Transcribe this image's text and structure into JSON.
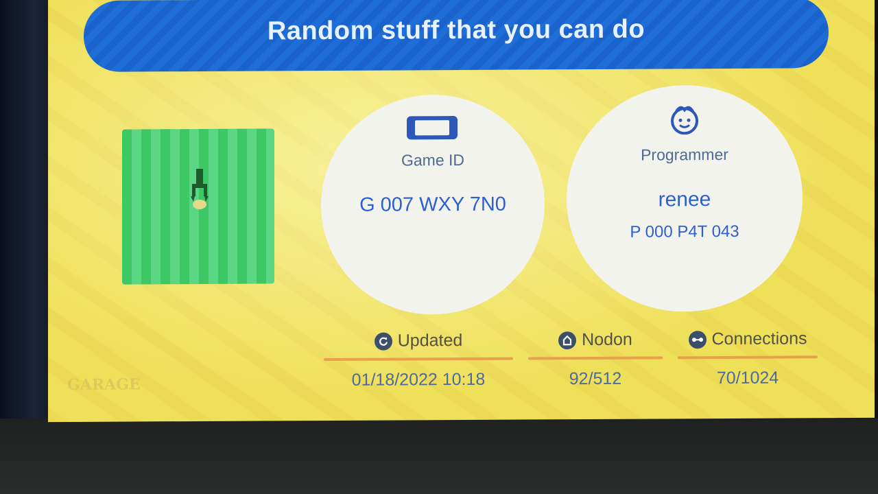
{
  "banner": {
    "title": "Random stuff that you can do"
  },
  "game": {
    "label": "Game ID",
    "id": "G 007 WXY 7N0"
  },
  "programmer": {
    "label": "Programmer",
    "name": "renee",
    "id": "P 000 P4T 043"
  },
  "stats": {
    "updated": {
      "label": "Updated",
      "value": "01/18/2022 10:18"
    },
    "nodon": {
      "label": "Nodon",
      "value": "92/512"
    },
    "connections": {
      "label": "Connections",
      "value": "70/1024"
    }
  },
  "logo": {
    "text": "GARAGE"
  },
  "colors": {
    "banner": "#1f6ed8",
    "background": "#efe05a",
    "accent_rule": "#e8a14a",
    "value_text": "#2d5fd0"
  }
}
